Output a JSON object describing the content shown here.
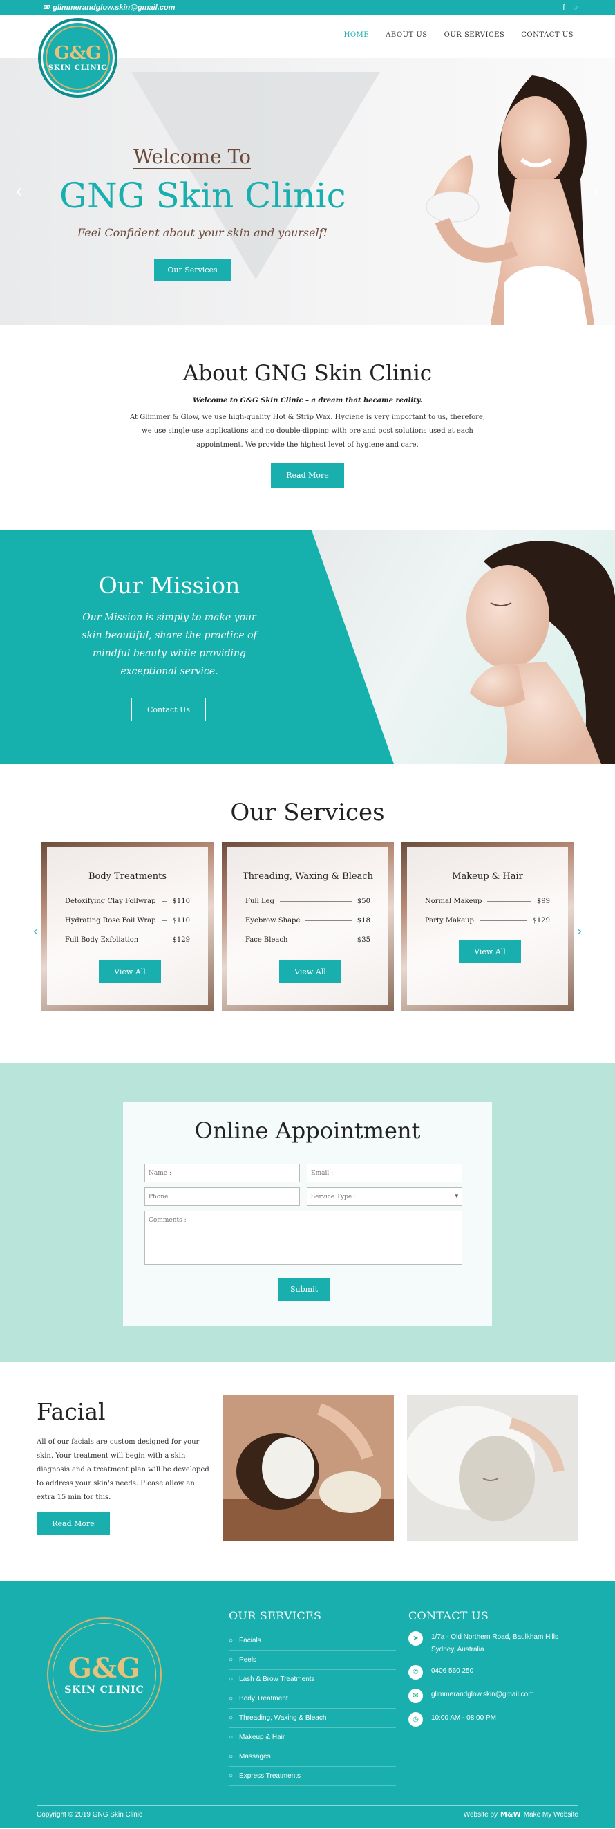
{
  "topbar": {
    "email": "glimmerandglow.skin@gmail.com",
    "social": [
      "facebook-icon",
      "instagram-icon"
    ]
  },
  "header": {
    "logo_mark": "G&G",
    "logo_text": "SKIN CLINIC",
    "nav": [
      "HOME",
      "ABOUT US",
      "OUR SERVICES",
      "CONTACT US"
    ],
    "active_nav": "HOME"
  },
  "hero": {
    "welcome": "Welcome To",
    "title": "GNG Skin Clinic",
    "tagline": "Feel Confident about your skin and yourself!",
    "button": "Our Services"
  },
  "about": {
    "title": "About GNG Skin Clinic",
    "subtitle": "Welcome to G&G Skin Clinic – a dream that became reality.",
    "body": "At Glimmer & Glow, we use high-quality Hot & Strip Wax. Hygiene is very important to us, therefore, we use single-use applications and no double-dipping with pre and post solutions used at each appointment. We provide the highest level of hygiene and care.",
    "button": "Read More"
  },
  "mission": {
    "title": "Our Mission",
    "text": "Our Mission is simply to make your skin beautiful, share the practice of mindful beauty while providing exceptional service.",
    "button": "Contact Us"
  },
  "services": {
    "title": "Our Services",
    "cards": [
      {
        "title": "Body Treatments",
        "items": [
          {
            "name": "Detoxifying Clay Foilwrap",
            "price": "$110"
          },
          {
            "name": "Hydrating Rose Foil Wrap",
            "price": "$110"
          },
          {
            "name": "Full Body Exfoliation",
            "price": "$129"
          }
        ],
        "button": "View All"
      },
      {
        "title": "Threading, Waxing & Bleach",
        "items": [
          {
            "name": "Full Leg",
            "price": "$50"
          },
          {
            "name": "Eyebrow Shape",
            "price": "$18"
          },
          {
            "name": "Face Bleach",
            "price": "$35"
          }
        ],
        "button": "View All"
      },
      {
        "title": "Makeup & Hair",
        "items": [
          {
            "name": "Normal Makeup",
            "price": "$99"
          },
          {
            "name": "Party Makeup",
            "price": "$129"
          }
        ],
        "button": "View All"
      }
    ]
  },
  "appointment": {
    "title": "Online Appointment",
    "name_placeholder": "Name :",
    "email_placeholder": "Email :",
    "phone_placeholder": "Phone :",
    "service_placeholder": "Service Type :",
    "comments_placeholder": "Comments :",
    "submit": "Submit"
  },
  "facial": {
    "title": "Facial",
    "text": "All of our facials are custom designed for your skin. Your treatment will begin with a skin diagnosis and a treatment plan will be developed to address your skin's needs. Please allow an extra 15 min for this.",
    "button": "Read More"
  },
  "footer": {
    "logo_mark": "G&G",
    "logo_text": "SKIN CLINIC",
    "services_title": "OUR SERVICES",
    "services": [
      "Facials",
      "Peels",
      "Lash & Brow Treatments",
      "Body Treatment",
      "Threading, Waxing & Bleach",
      "Makeup & Hair",
      "Massages",
      "Express Treatments"
    ],
    "contact_title": "CONTACT US",
    "address": "1/7a - Old Northern Road, Baulkham Hills Sydney, Australia",
    "phone": "0406 560 250",
    "email": "glimmerandglow.skin@gmail.com",
    "hours": "10:00 AM - 08:00 PM",
    "copyright": "Copyright © 2019 GNG Skin Clinic",
    "credit_prefix": "Website by",
    "credit_mark": "M&W",
    "credit_name": "Make My Website"
  },
  "colors": {
    "accent": "#1aafaf",
    "heading_brown": "#6b4a3a",
    "mint": "#b9e4da"
  }
}
